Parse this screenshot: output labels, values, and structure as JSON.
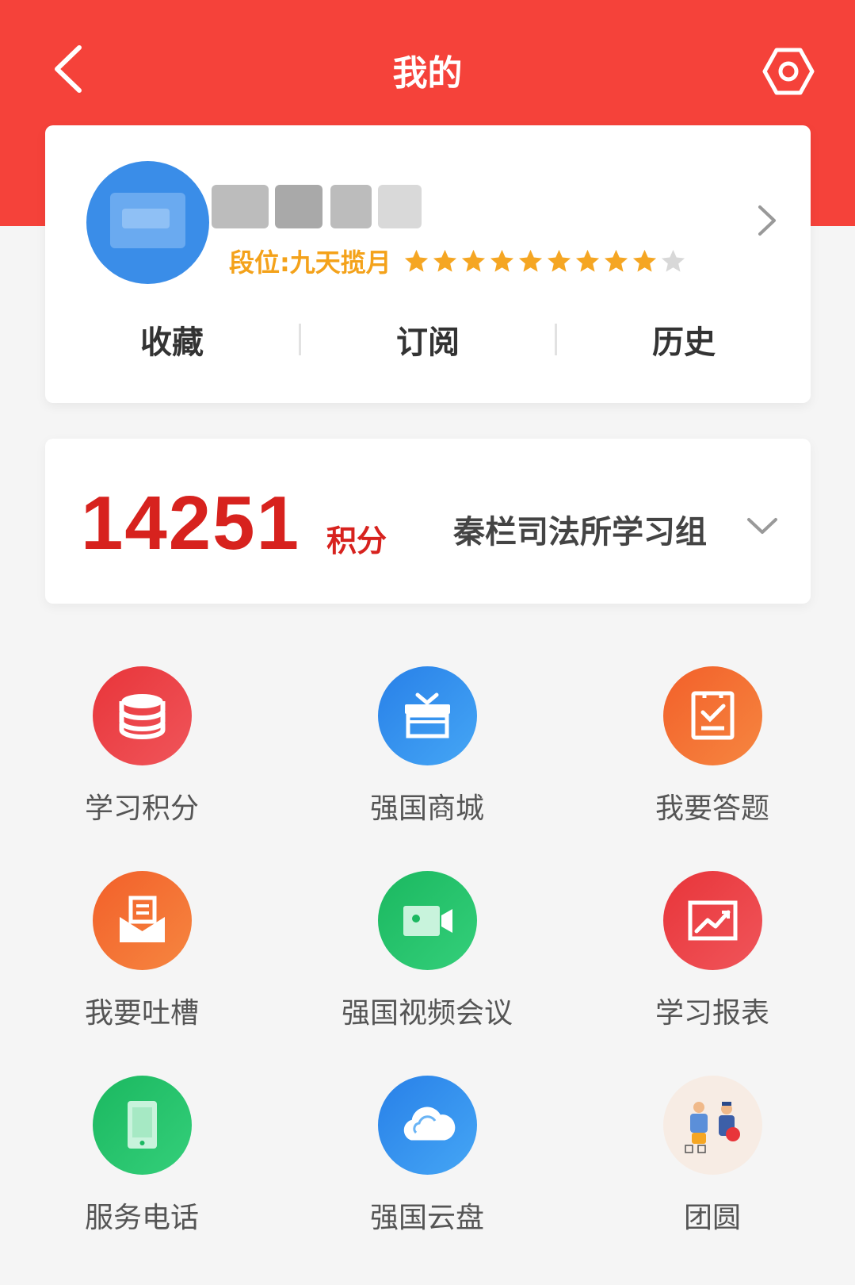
{
  "header": {
    "title": "我的",
    "back_icon": "chevron-left-icon",
    "settings_icon": "hexagon-settings-icon"
  },
  "profile": {
    "rank_label": "段位:九天揽月",
    "stars_filled": 9,
    "stars_total": 10,
    "star_color": "#f5a623",
    "quick_links": [
      "收藏",
      "订阅",
      "历史"
    ]
  },
  "points": {
    "value": "14251",
    "unit": "积分",
    "group": "秦栏司法所学习组"
  },
  "features": [
    {
      "label": "学习积分",
      "icon": "database-icon",
      "color": "#e8353a"
    },
    {
      "label": "强国商城",
      "icon": "gift-box-icon",
      "color": "#2f8ef0"
    },
    {
      "label": "我要答题",
      "icon": "clipboard-check-icon",
      "color": "#f46a2c"
    },
    {
      "label": "我要吐槽",
      "icon": "envelope-icon",
      "color": "#f46a2c"
    },
    {
      "label": "强国视频会议",
      "icon": "video-camera-icon",
      "color": "#22c268"
    },
    {
      "label": "学习报表",
      "icon": "chart-report-icon",
      "color": "#e8353a"
    },
    {
      "label": "服务电话",
      "icon": "phone-icon",
      "color": "#22c268"
    },
    {
      "label": "强国云盘",
      "icon": "cloud-icon",
      "color": "#2f8ef0"
    },
    {
      "label": "团圆",
      "icon": "reunion-illustration-icon",
      "color": "#f7ece4"
    }
  ],
  "theme": {
    "primary_red": "#f5423a",
    "points_red": "#d7221e"
  }
}
